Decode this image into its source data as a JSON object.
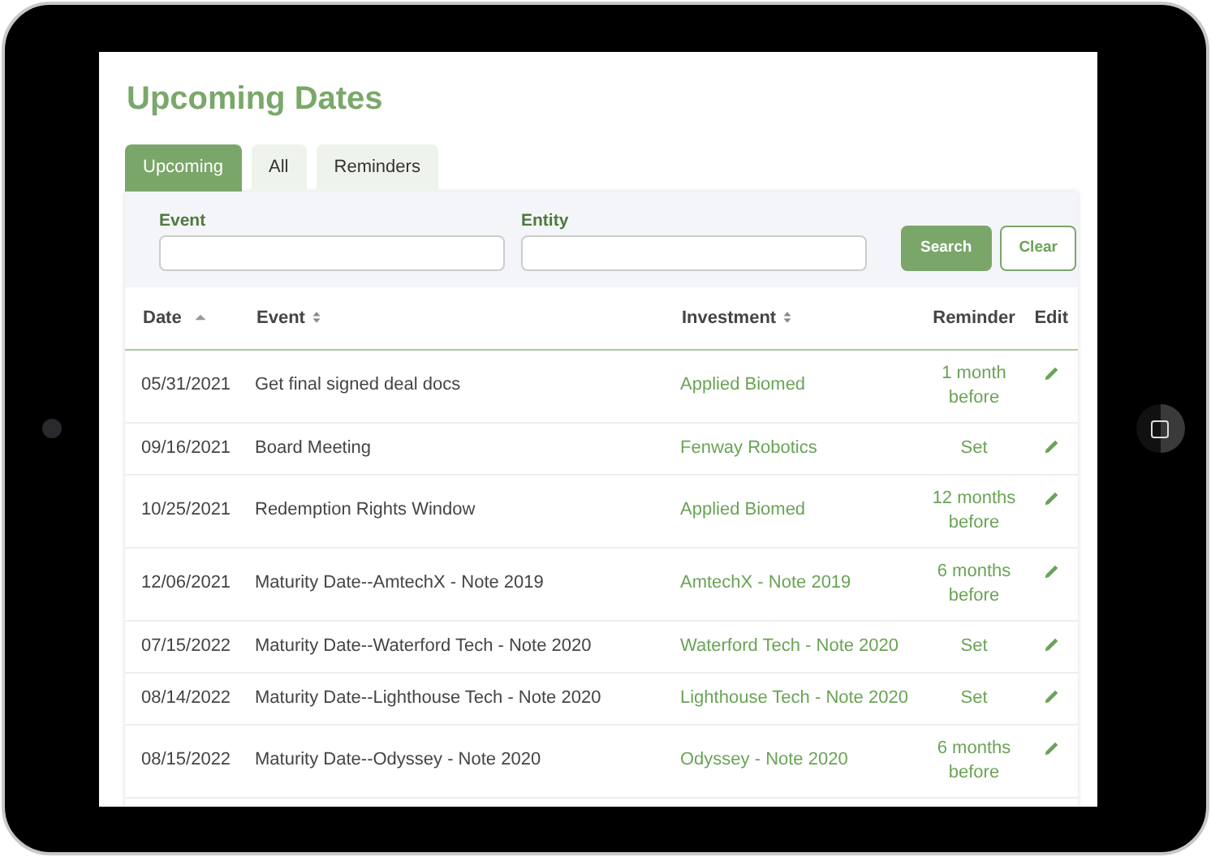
{
  "page": {
    "title": "Upcoming Dates"
  },
  "tabs": [
    {
      "label": "Upcoming",
      "selected": true
    },
    {
      "label": "All",
      "selected": false
    },
    {
      "label": "Reminders",
      "selected": false
    }
  ],
  "filters": [
    {
      "label": "Event"
    },
    {
      "label": "Entity"
    }
  ],
  "buttons": [
    {
      "label": "Search",
      "kind": "primary"
    },
    {
      "label": "Clear",
      "kind": "outline"
    }
  ],
  "table": {
    "columns": [
      {
        "label": "Date",
        "kind": "sorted"
      },
      {
        "label": "Event",
        "kind": "sortable"
      },
      {
        "label": "Investment",
        "kind": "sortable"
      },
      {
        "label": "Reminder",
        "kind": "plain"
      },
      {
        "label": "Edit",
        "kind": "plain"
      }
    ],
    "rows": [
      {
        "date": "05/31/2021",
        "event": "Get final signed deal docs",
        "investment": "Applied Biomed",
        "reminder": "1 month before"
      },
      {
        "date": "09/16/2021",
        "event": "Board Meeting",
        "investment": "Fenway Robotics",
        "reminder": "Set"
      },
      {
        "date": "10/25/2021",
        "event": "Redemption Rights Window",
        "investment": "Applied Biomed",
        "reminder": "12 months before"
      },
      {
        "date": "12/06/2021",
        "event": "Maturity Date--AmtechX - Note 2019",
        "investment": "AmtechX - Note 2019",
        "reminder": "6 months before"
      },
      {
        "date": "07/15/2022",
        "event": "Maturity Date--Waterford Tech - Note 2020",
        "investment": "Waterford Tech - Note 2020",
        "reminder": "Set"
      },
      {
        "date": "08/14/2022",
        "event": "Maturity Date--Lighthouse Tech - Note 2020",
        "investment": "Lighthouse Tech - Note 2020",
        "reminder": "Set"
      },
      {
        "date": "08/15/2022",
        "event": "Maturity Date--Odyssey - Note 2020",
        "investment": "Odyssey - Note 2020",
        "reminder": "6 months before"
      }
    ]
  }
}
